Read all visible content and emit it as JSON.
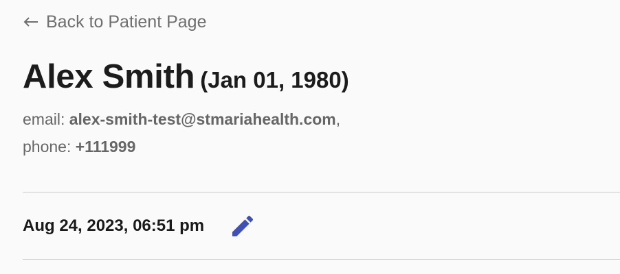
{
  "nav": {
    "back_label": "Back to Patient Page"
  },
  "patient": {
    "name": "Alex Smith",
    "dob": "(Jan 01, 1980)",
    "email_label": "email: ",
    "email": "alex-smith-test@stmariahealth.com",
    "email_suffix": ",",
    "phone_label": "phone: ",
    "phone": "+111999"
  },
  "entry": {
    "date": "Aug 24, 2023, 06:51 pm",
    "edit_icon": "pencil-icon"
  },
  "colors": {
    "accent": "#3f51b5",
    "text_muted": "#6f6f6f",
    "text_dark": "#1c1c1c",
    "divider": "#c9c9c9",
    "background": "#fafafa"
  }
}
